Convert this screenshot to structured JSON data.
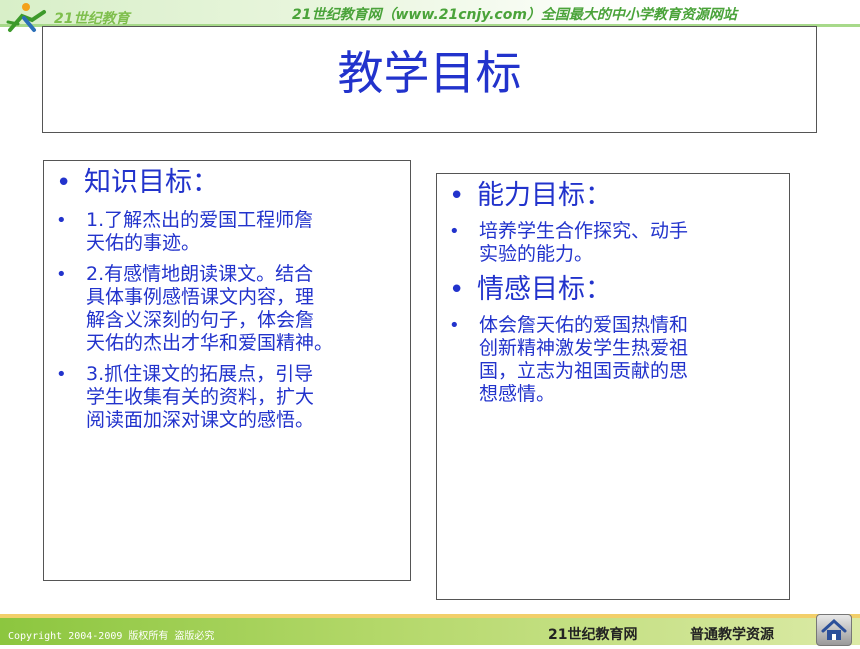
{
  "header": {
    "logo_text": "21世纪教育",
    "site_slogan": "21世纪教育网（www.21cnjy.com）全国最大的中小学教育资源网站"
  },
  "slide": {
    "title": "教学目标"
  },
  "left_panel": {
    "heading": "知识目标：",
    "items": [
      "1.了解杰出的爱国工程师詹\n天佑的事迹。",
      "2.有感情地朗读课文。结合\n具体事例感悟课文内容，理\n解含义深刻的句子，体会詹\n天佑的杰出才华和爱国精神。",
      "3.抓住课文的拓展点，引导\n学生收集有关的资料，扩大\n阅读面加深对课文的感悟。"
    ]
  },
  "right_panel": {
    "heading1": "能力目标：",
    "item1": "培养学生合作探究、动手\n实验的能力。",
    "heading2": "情感目标：",
    "item2": "体会詹天佑的爱国热情和\n创新精神激发学生热爱祖\n国，立志为祖国贡献的思\n想感情。"
  },
  "footer": {
    "copyright": "Copyright 2004-2009 版权所有 盗版必究",
    "site": "21世纪教育网",
    "resource": "普通教学资源"
  },
  "icons": {
    "logo": "runner-logo-icon",
    "home": "home-icon"
  },
  "colors": {
    "title_blue": "#2233cc",
    "header_green": "#4aa33a",
    "footer_green": "#8cc63f"
  }
}
